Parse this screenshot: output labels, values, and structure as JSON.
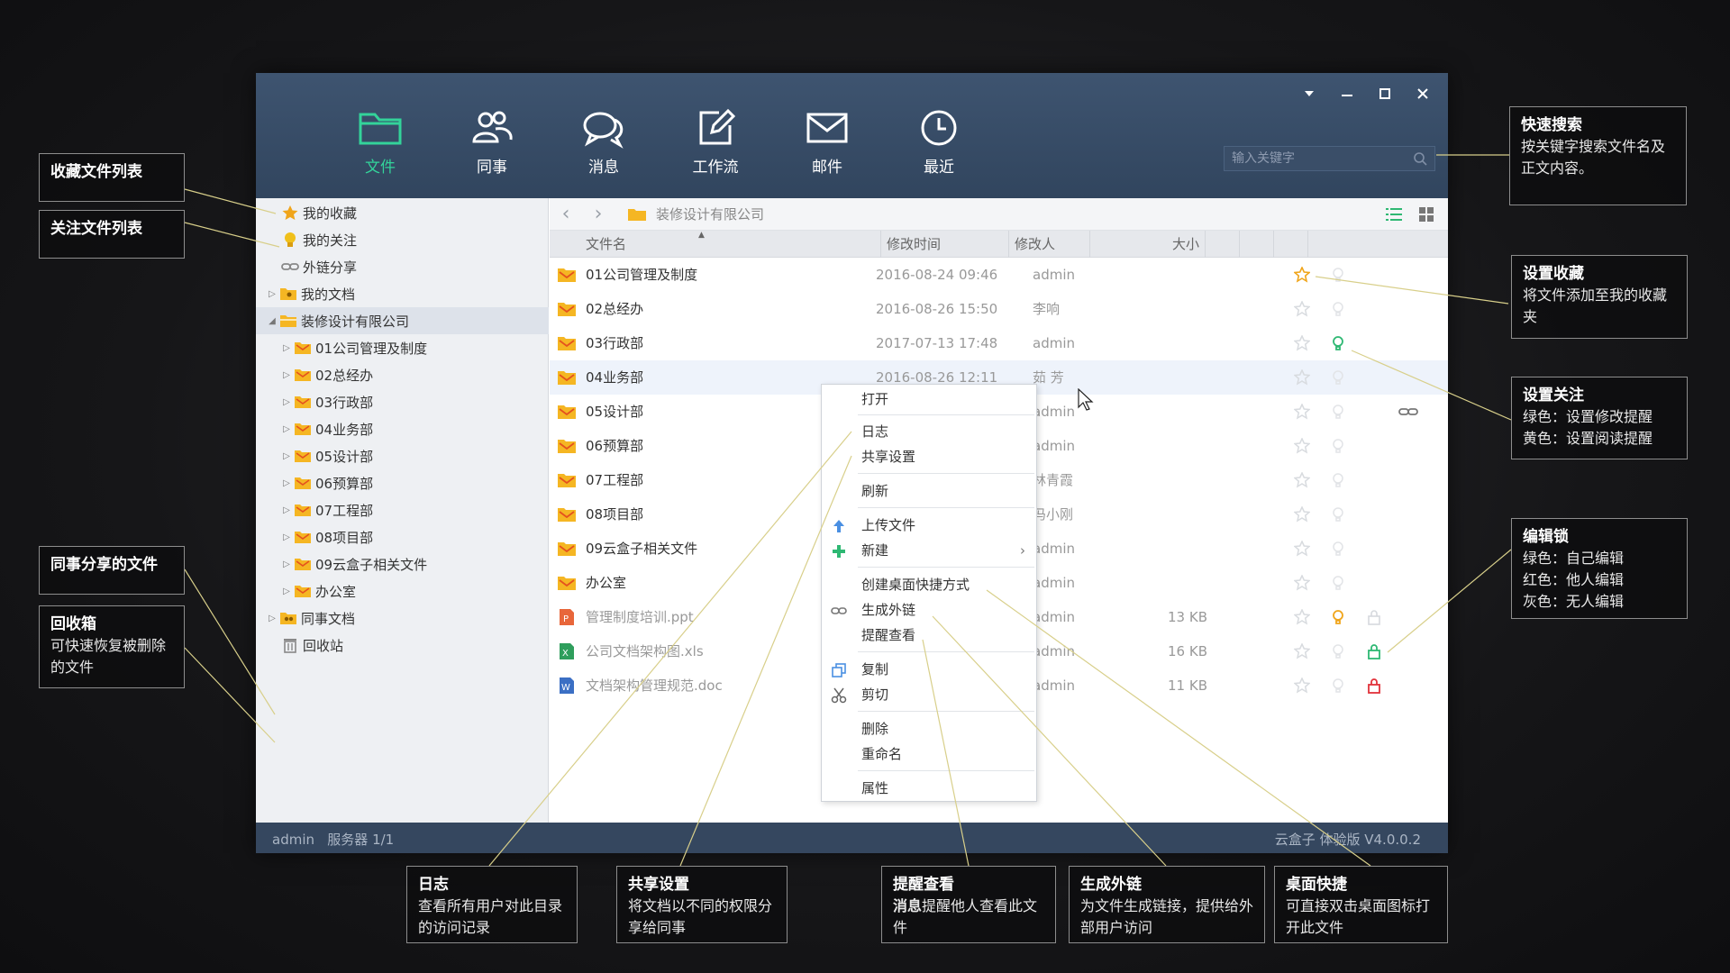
{
  "window": {
    "nav": [
      {
        "label": "文件",
        "icon": "folder-icon"
      },
      {
        "label": "同事",
        "icon": "colleagues-icon"
      },
      {
        "label": "消息",
        "icon": "chat-icon"
      },
      {
        "label": "工作流",
        "icon": "edit-icon"
      },
      {
        "label": "邮件",
        "icon": "mail-icon"
      },
      {
        "label": "最近",
        "icon": "clock-icon"
      }
    ],
    "search_placeholder": "输入关键字"
  },
  "sidebar": {
    "items": [
      {
        "label": "我的收藏",
        "icon": "star-icon"
      },
      {
        "label": "我的关注",
        "icon": "bulb-icon"
      },
      {
        "label": "外链分享",
        "icon": "link-icon"
      },
      {
        "label": "我的文档",
        "icon": "folder-user-icon"
      },
      {
        "label": "装修设计有限公司",
        "icon": "folder-icon"
      },
      {
        "label": "01公司管理及制度",
        "icon": "folder-icon"
      },
      {
        "label": "02总经办",
        "icon": "folder-icon"
      },
      {
        "label": "03行政部",
        "icon": "folder-icon"
      },
      {
        "label": "04业务部",
        "icon": "folder-icon"
      },
      {
        "label": "05设计部",
        "icon": "folder-icon"
      },
      {
        "label": "06预算部",
        "icon": "folder-icon"
      },
      {
        "label": "07工程部",
        "icon": "folder-icon"
      },
      {
        "label": "08项目部",
        "icon": "folder-icon"
      },
      {
        "label": "09云盒子相关文件",
        "icon": "folder-icon"
      },
      {
        "label": "办公室",
        "icon": "folder-icon"
      },
      {
        "label": "同事文档",
        "icon": "folder-user-icon"
      },
      {
        "label": "回收站",
        "icon": "trash-icon"
      }
    ]
  },
  "path": {
    "current": "装修设计有限公司"
  },
  "table": {
    "columns": [
      "文件名",
      "修改时间",
      "修改人",
      "大小"
    ],
    "rows": [
      {
        "name": "01公司管理及制度",
        "time": "2016-08-24 09:46",
        "user": "admin",
        "size": ""
      },
      {
        "name": "02总经办",
        "time": "2016-08-26 15:50",
        "user": "李响",
        "size": ""
      },
      {
        "name": "03行政部",
        "time": "2017-07-13 17:48",
        "user": "admin",
        "size": ""
      },
      {
        "name": "04业务部",
        "time": "2016-08-26 12:11",
        "user": "茹 芳",
        "size": ""
      },
      {
        "name": "05设计部",
        "time": "",
        "user": "admin",
        "size": ""
      },
      {
        "name": "06预算部",
        "time": "",
        "user": "admin",
        "size": ""
      },
      {
        "name": "07工程部",
        "time": "",
        "user": "林青霞",
        "size": ""
      },
      {
        "name": "08项目部",
        "time": "",
        "user": "冯小刚",
        "size": ""
      },
      {
        "name": "09云盒子相关文件",
        "time": "",
        "user": "admin",
        "size": ""
      },
      {
        "name": "办公室",
        "time": "",
        "user": "admin",
        "size": ""
      },
      {
        "name": "管理制度培训.ppt",
        "time": "",
        "user": "admin",
        "size": "13 KB"
      },
      {
        "name": "公司文档架构图.xls",
        "time": "",
        "user": "admin",
        "size": "16 KB"
      },
      {
        "name": "文档架构管理规范.doc",
        "time": "",
        "user": "admin",
        "size": "11 KB"
      }
    ]
  },
  "context_menu": {
    "items": [
      "打开",
      "日志",
      "共享设置",
      "刷新",
      "上传文件",
      "新建",
      "创建桌面快捷方式",
      "生成外链",
      "提醒查看",
      "复制",
      "剪切",
      "删除",
      "重命名",
      "属性"
    ],
    "submenu_arrow": "›"
  },
  "status": {
    "left": "admin   服务器 1/1",
    "right": "云盒子 体验版 V4.0.0.2"
  },
  "callouts": {
    "fav_list": {
      "title": "收藏文件列表"
    },
    "follow_list": {
      "title": "关注文件列表"
    },
    "colleague_shared": {
      "title": "同事分享的文件"
    },
    "recycle": {
      "title": "回收箱",
      "desc": "可快速恢复被删除的文件"
    },
    "quick_search": {
      "title": "快速搜索",
      "desc": "按关键字搜索文件名及正文内容。"
    },
    "set_fav": {
      "title": "设置收藏",
      "desc": "将文件添加至我的收藏夹"
    },
    "set_follow": {
      "title": "设置关注",
      "desc1": "绿色：设置修改提醒",
      "desc2": "黄色：设置阅读提醒"
    },
    "edit_lock": {
      "title": "编辑锁",
      "desc1": "绿色：自己编辑",
      "desc2": "红色：他人编辑",
      "desc3": "灰色：无人编辑"
    },
    "log": {
      "title": "日志",
      "desc": "查看所有用户对此目录的访问记录"
    },
    "share_settings": {
      "title": "共享设置",
      "desc": "将文档以不同的权限分享给同事"
    },
    "remind": {
      "title": "提醒查看",
      "desc_bold": "消息",
      "desc": "提醒他人查看此文件"
    },
    "gen_link": {
      "title": "生成外链",
      "desc": "为文件生成链接，提供给外部用户访问"
    },
    "desktop_shortcut": {
      "title": "桌面快捷",
      "desc": "可直接双击桌面图标打开此文件"
    }
  },
  "colors": {
    "accent": "#33d39a",
    "titlebar": "#33475f",
    "star": "#f0a51b",
    "lock_green": "#2eb873",
    "lock_red": "#e2323a",
    "folder": "#f5b623"
  }
}
